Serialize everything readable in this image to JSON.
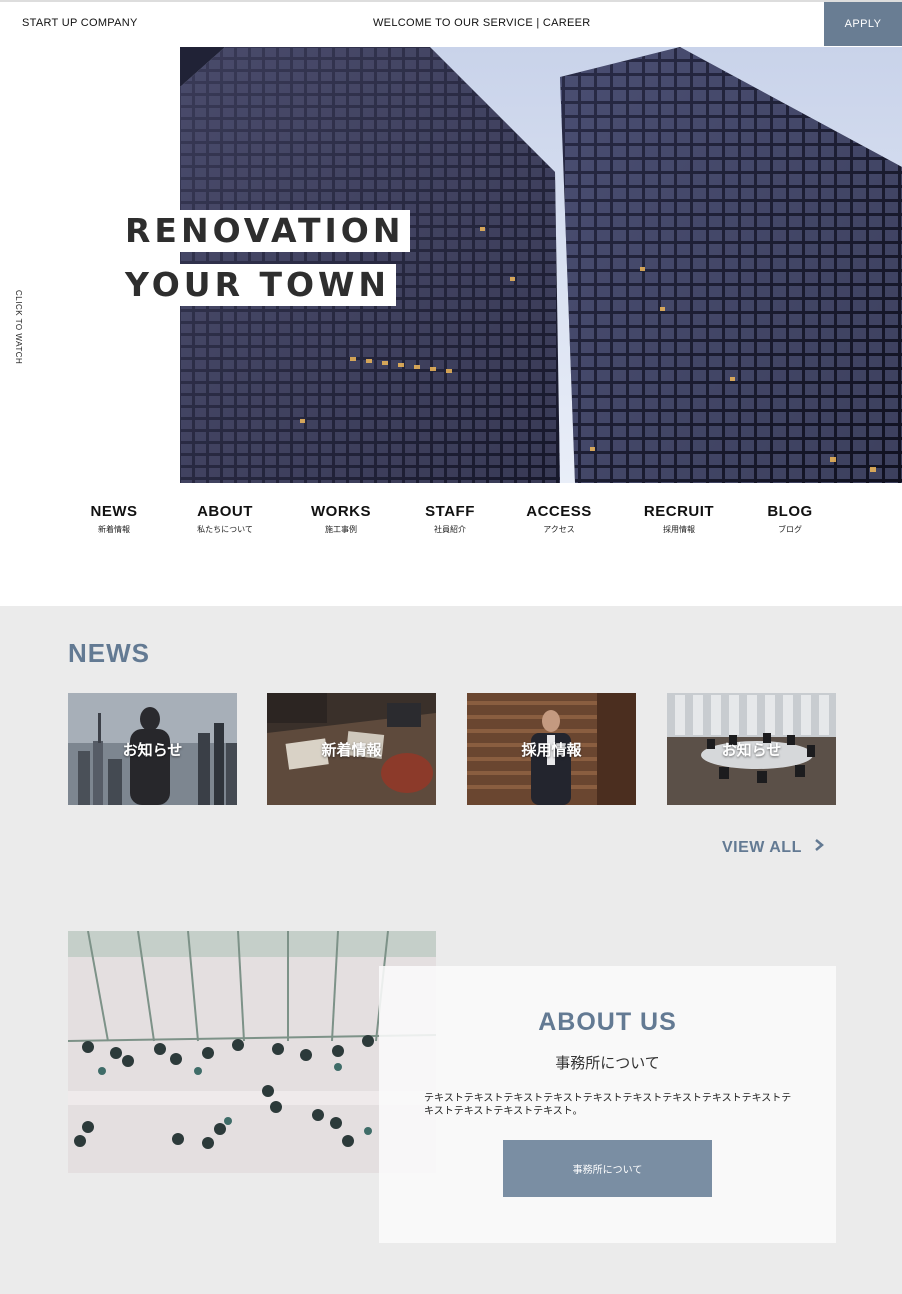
{
  "header": {
    "logo": "START UP COMPANY",
    "welcome": "WELCOME TO OUR SERVICE | CAREER",
    "apply_label": "APPLY"
  },
  "hero": {
    "line1": "RENOVATION",
    "line2": "YOUR TOWN",
    "click_to_watch": "CLICK TO WATCH"
  },
  "nav": {
    "items": [
      {
        "en": "NEWS",
        "jp": "新着情報"
      },
      {
        "en": "ABOUT",
        "jp": "私たちについて"
      },
      {
        "en": "WORKS",
        "jp": "施工事例"
      },
      {
        "en": "STAFF",
        "jp": "社員紹介"
      },
      {
        "en": "ACCESS",
        "jp": "アクセス"
      },
      {
        "en": "RECRUIT",
        "jp": "採用情報"
      },
      {
        "en": "BLOG",
        "jp": "ブログ"
      }
    ]
  },
  "news": {
    "title": "NEWS",
    "cards": [
      {
        "label": "お知らせ"
      },
      {
        "label": "新着情報"
      },
      {
        "label": "採用情報"
      },
      {
        "label": "お知らせ"
      }
    ],
    "view_all": "VIEW ALL"
  },
  "about": {
    "title": "ABOUT US",
    "subtitle": "事務所について",
    "text": "テキストテキストテキストテキストテキストテキストテキストテキストテキストテキストテキストテキストテキスト。",
    "button_label": "事務所について"
  },
  "colors": {
    "accent": "#637a93",
    "button": "#7a8ea3",
    "section_bg": "#ebebeb"
  }
}
